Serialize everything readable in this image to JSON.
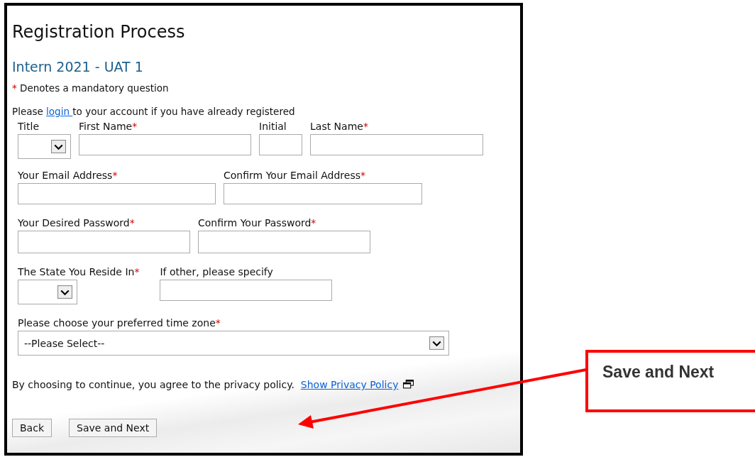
{
  "page": {
    "title": "Registration Process",
    "subtitle": "Intern 2021 - UAT 1",
    "required_mark": "*",
    "mandatory_note": "Denotes a mandatory question",
    "login_prompt": {
      "before": "Please ",
      "link": "login ",
      "after": "to your account if you have already registered"
    }
  },
  "form_rows": [
    {
      "fields": [
        {
          "kind": "select",
          "label": "Title",
          "required": false
        },
        {
          "kind": "text",
          "label": "First Name",
          "required": true
        },
        {
          "kind": "text",
          "label": "Initial",
          "required": false
        },
        {
          "kind": "text",
          "label": "Last Name",
          "required": true
        }
      ]
    },
    {
      "fields": [
        {
          "kind": "text",
          "label": "Your Email Address",
          "required": true
        },
        {
          "kind": "text",
          "label": "Confirm Your Email Address",
          "required": true
        }
      ]
    },
    {
      "fields": [
        {
          "kind": "text",
          "label": "Your Desired Password",
          "required": true
        },
        {
          "kind": "text",
          "label": "Confirm Your Password",
          "required": true
        }
      ]
    },
    {
      "fields": [
        {
          "kind": "select",
          "label": "The State You Reside In",
          "required": true
        },
        {
          "kind": "text",
          "label": "If other, please specify",
          "required": false
        }
      ]
    },
    {
      "fields": [
        {
          "kind": "select",
          "label": "Please choose your preferred time zone",
          "required": true,
          "value": "--Please Select--"
        }
      ]
    }
  ],
  "privacy": {
    "text": "By choosing to continue, you agree to the privacy policy.",
    "link": "Show Privacy Policy"
  },
  "buttons": [
    "Back",
    "Save and Next"
  ],
  "callout": {
    "text": "Save and Next"
  }
}
